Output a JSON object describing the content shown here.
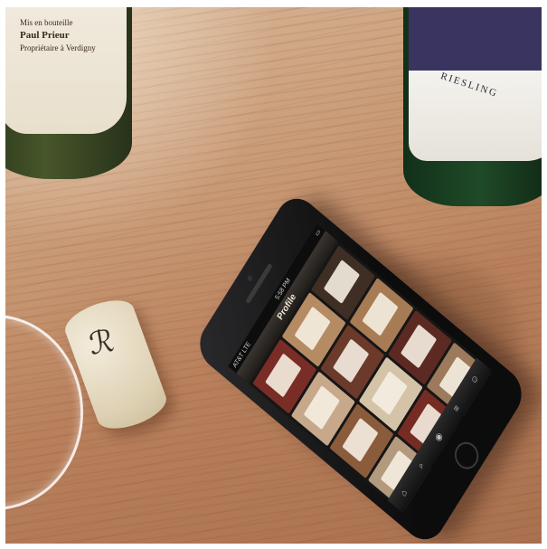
{
  "scene": {
    "description_items": [
      "wine-bottle-left",
      "wine-bottle-right",
      "wine-glass",
      "cork",
      "smartphone"
    ]
  },
  "bottle_left": {
    "label_lines": [
      "Mis en bouteille",
      "Paul Prieur",
      "Propriétaire à Verdigny"
    ]
  },
  "bottle_right": {
    "label_text": "RIESLING"
  },
  "phone": {
    "status_carrier": "AT&T LTE",
    "status_time": "5:58 PM",
    "nav_title": "Profile",
    "tiles": [
      {
        "color": "#7a2d27"
      },
      {
        "color": "#b58b64"
      },
      {
        "color": "#3f2e23"
      },
      {
        "color": "#c7a88b"
      },
      {
        "color": "#6b3a2a"
      },
      {
        "color": "#a77c55"
      },
      {
        "color": "#8a5c3c"
      },
      {
        "color": "#d5c3a8"
      },
      {
        "color": "#5c2a22"
      },
      {
        "color": "#b39a7d"
      },
      {
        "color": "#762c23"
      },
      {
        "color": "#9c7a5b"
      }
    ],
    "tab_icons": [
      "home-icon",
      "search-icon",
      "camera-icon",
      "list-icon",
      "profile-icon"
    ]
  },
  "cork": {
    "mark": "ℛ"
  }
}
